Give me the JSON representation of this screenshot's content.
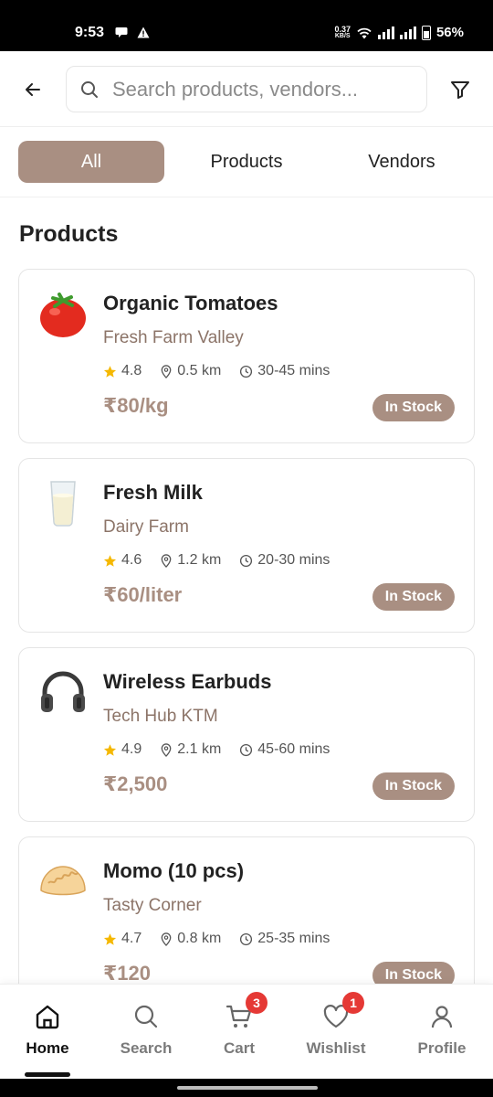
{
  "status_bar": {
    "time": "9:53",
    "net_speed_value": "0.37",
    "net_speed_unit": "KB/S",
    "battery": "56%"
  },
  "header": {
    "search_placeholder": "Search products, vendors..."
  },
  "tabs": [
    {
      "label": "All",
      "active": true
    },
    {
      "label": "Products",
      "active": false
    },
    {
      "label": "Vendors",
      "active": false
    }
  ],
  "section_title": "Products",
  "products": [
    {
      "name": "Organic Tomatoes",
      "vendor": "Fresh Farm Valley",
      "rating": "4.8",
      "distance": "0.5 km",
      "time": "30-45 mins",
      "price": "₹80/kg",
      "stock": "In Stock",
      "icon": "tomato-icon"
    },
    {
      "name": "Fresh Milk",
      "vendor": "Dairy Farm",
      "rating": "4.6",
      "distance": "1.2 km",
      "time": "20-30 mins",
      "price": "₹60/liter",
      "stock": "In Stock",
      "icon": "milk-glass-icon"
    },
    {
      "name": "Wireless Earbuds",
      "vendor": "Tech Hub KTM",
      "rating": "4.9",
      "distance": "2.1 km",
      "time": "45-60 mins",
      "price": "₹2,500",
      "stock": "In Stock",
      "icon": "headphones-icon"
    },
    {
      "name": "Momo (10 pcs)",
      "vendor": "Tasty Corner",
      "rating": "4.7",
      "distance": "0.8 km",
      "time": "25-35 mins",
      "price": "₹120",
      "stock": "In Stock",
      "icon": "dumpling-icon"
    }
  ],
  "bottom_nav": [
    {
      "label": "Home",
      "icon": "home-icon",
      "active": true
    },
    {
      "label": "Search",
      "icon": "search-icon",
      "active": false
    },
    {
      "label": "Cart",
      "icon": "cart-icon",
      "badge": "3",
      "active": false
    },
    {
      "label": "Wishlist",
      "icon": "heart-icon",
      "badge": "1",
      "active": false
    },
    {
      "label": "Profile",
      "icon": "user-icon",
      "active": false
    }
  ],
  "colors": {
    "accent": "#a98f82",
    "vendor_text": "#8c7468",
    "badge_red": "#e53935",
    "star": "#f5b800"
  }
}
